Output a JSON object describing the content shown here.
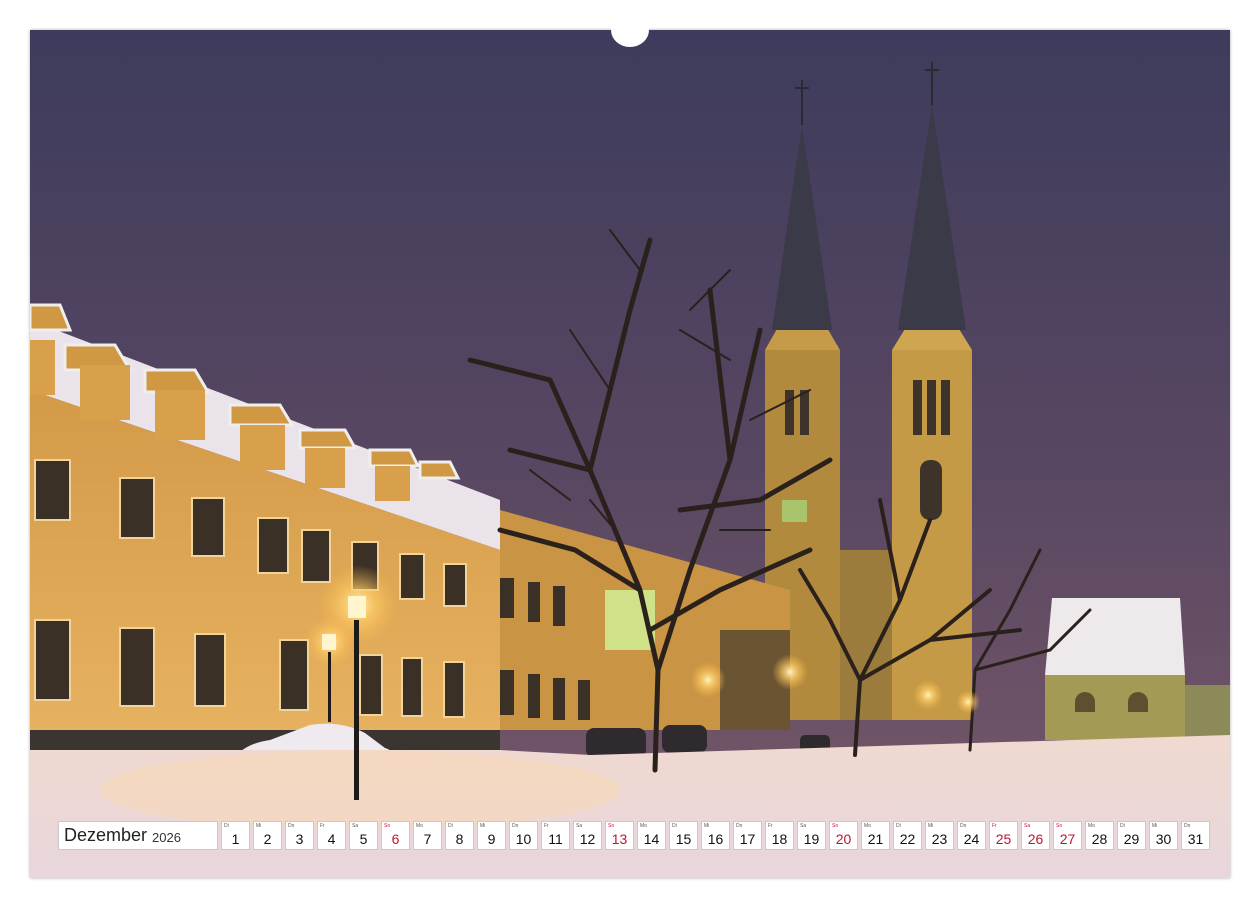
{
  "calendar": {
    "month": "Dezember",
    "year": "2026",
    "days": [
      {
        "dow": "Di",
        "num": "1",
        "type": "normal"
      },
      {
        "dow": "Mi",
        "num": "2",
        "type": "normal"
      },
      {
        "dow": "Do",
        "num": "3",
        "type": "normal"
      },
      {
        "dow": "Fr",
        "num": "4",
        "type": "normal"
      },
      {
        "dow": "Sa",
        "num": "5",
        "type": "normal"
      },
      {
        "dow": "So",
        "num": "6",
        "type": "sunday"
      },
      {
        "dow": "Mo",
        "num": "7",
        "type": "normal"
      },
      {
        "dow": "Di",
        "num": "8",
        "type": "normal"
      },
      {
        "dow": "Mi",
        "num": "9",
        "type": "normal"
      },
      {
        "dow": "Do",
        "num": "10",
        "type": "normal"
      },
      {
        "dow": "Fr",
        "num": "11",
        "type": "normal"
      },
      {
        "dow": "Sa",
        "num": "12",
        "type": "normal"
      },
      {
        "dow": "So",
        "num": "13",
        "type": "sunday"
      },
      {
        "dow": "Mo",
        "num": "14",
        "type": "normal"
      },
      {
        "dow": "Di",
        "num": "15",
        "type": "normal"
      },
      {
        "dow": "Mi",
        "num": "16",
        "type": "normal"
      },
      {
        "dow": "Do",
        "num": "17",
        "type": "normal"
      },
      {
        "dow": "Fr",
        "num": "18",
        "type": "normal"
      },
      {
        "dow": "Sa",
        "num": "19",
        "type": "normal"
      },
      {
        "dow": "So",
        "num": "20",
        "type": "sunday"
      },
      {
        "dow": "Mo",
        "num": "21",
        "type": "normal"
      },
      {
        "dow": "Di",
        "num": "22",
        "type": "normal"
      },
      {
        "dow": "Mi",
        "num": "23",
        "type": "normal"
      },
      {
        "dow": "Do",
        "num": "24",
        "type": "normal"
      },
      {
        "dow": "Fr",
        "num": "25",
        "type": "holiday"
      },
      {
        "dow": "Sa",
        "num": "26",
        "type": "holiday"
      },
      {
        "dow": "So",
        "num": "27",
        "type": "sunday"
      },
      {
        "dow": "Mo",
        "num": "28",
        "type": "normal"
      },
      {
        "dow": "Di",
        "num": "29",
        "type": "normal"
      },
      {
        "dow": "Mi",
        "num": "30",
        "type": "normal"
      },
      {
        "dow": "Do",
        "num": "31",
        "type": "normal"
      }
    ]
  },
  "colors": {
    "holiday_red": "#c4122f",
    "sky_top": "#3b3a5a",
    "sky_bottom": "#6f4f66",
    "facade": "#d9a04c",
    "snow": "#f1e2dc"
  },
  "icons": {
    "binding": "spiral-binding-icon",
    "hanger": "hanger-notch-icon"
  }
}
